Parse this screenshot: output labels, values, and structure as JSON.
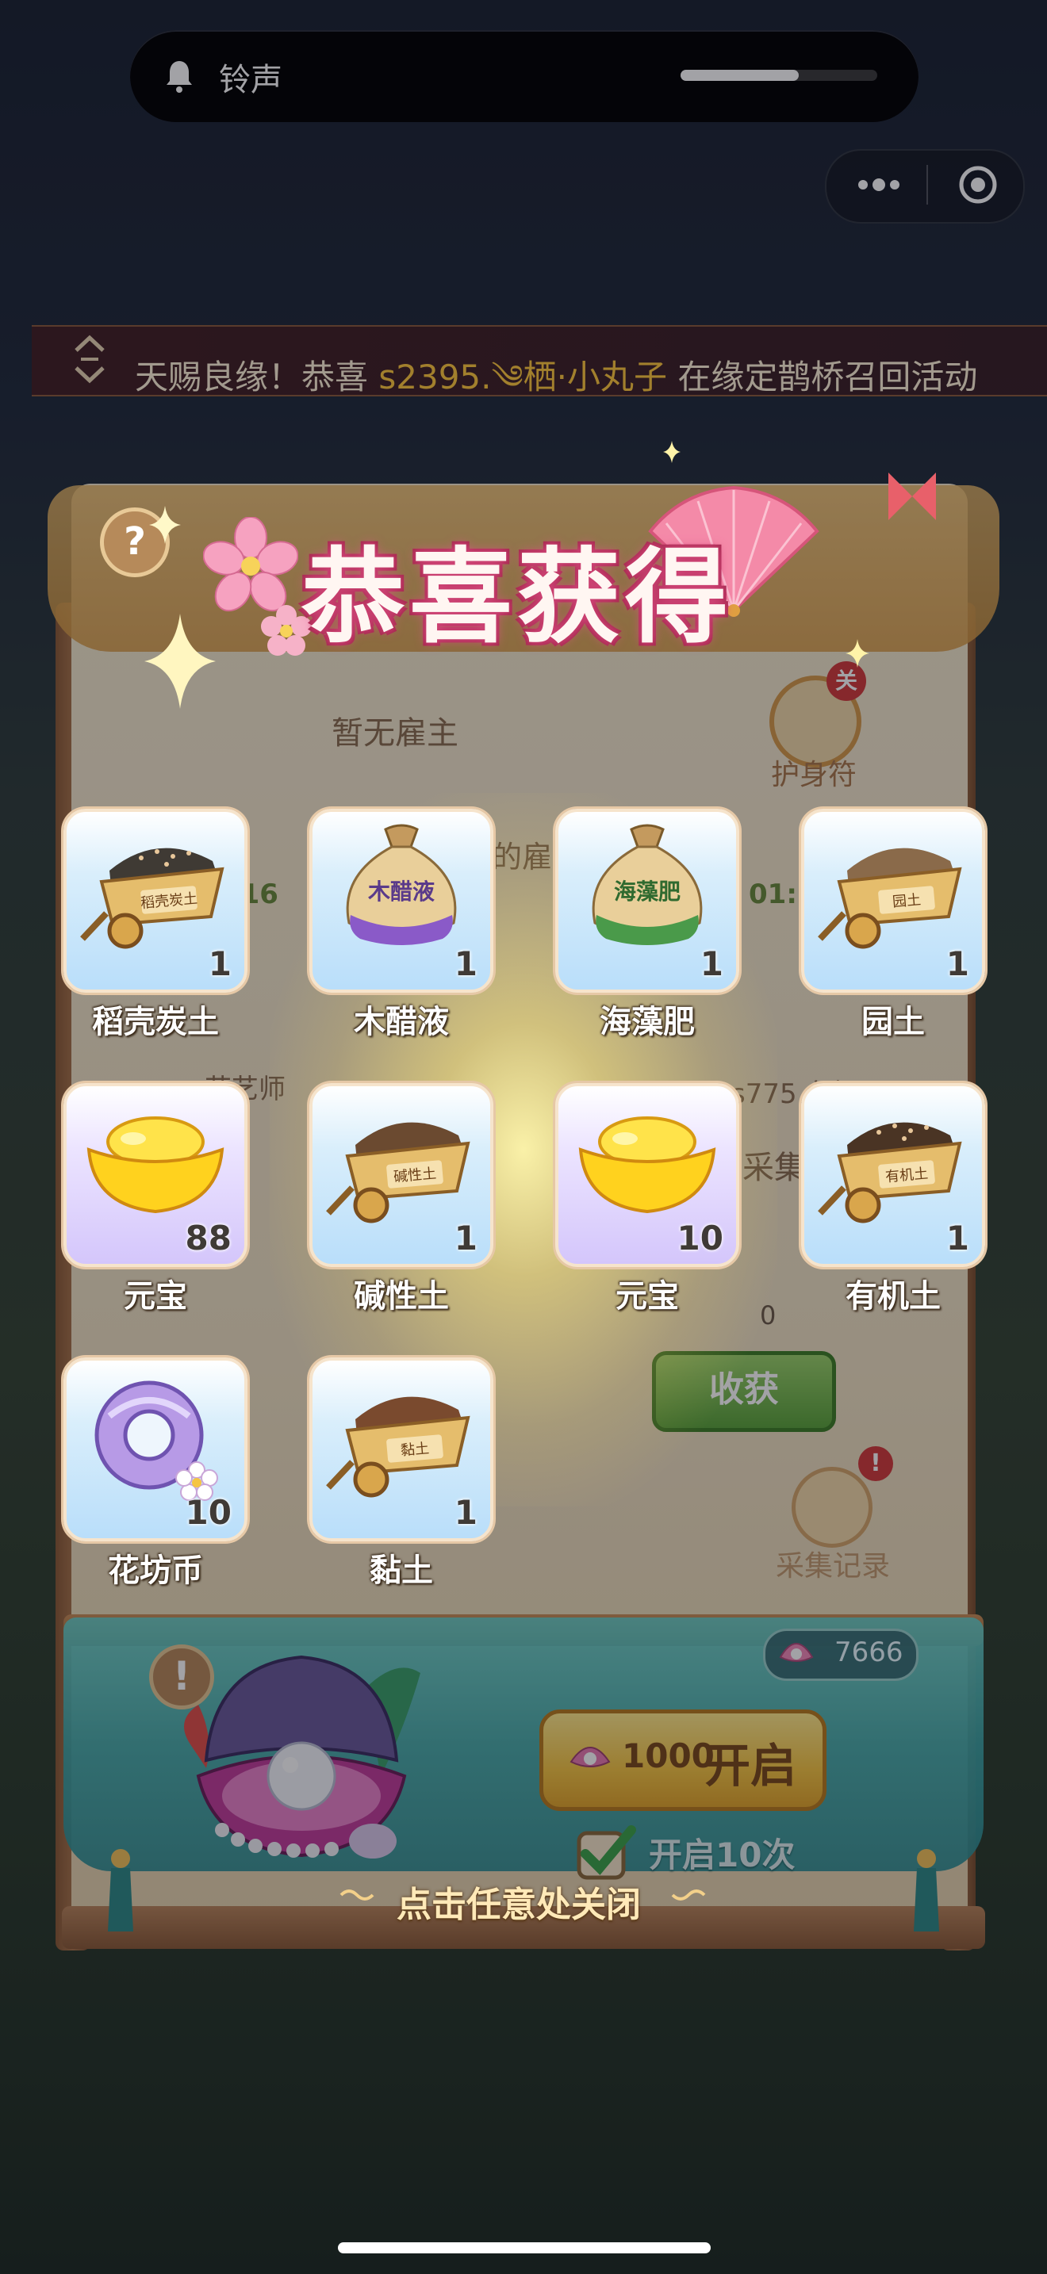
{
  "status_bar": {
    "mode_label": "铃声",
    "volume_level": 0.6
  },
  "marquee": {
    "prefix": "天赐良缘！恭喜",
    "player_name": "s2395.༄栖·小丸子",
    "suffix": "在缘定鹊桥召回活动"
  },
  "background_panel": {
    "no_employer": "暂无雇主",
    "amulet_badge": "关",
    "amulet_label": "护身符",
    "hire_text": "的雇",
    "time_left": ":16",
    "time_right": "01:5",
    "role_text": "花艺师",
    "server_text": "s775.九妈",
    "collect_text": "采集",
    "pearl_count_small": "0",
    "harvest_button": "收获",
    "record_badge": "!",
    "record_label": "采集记录"
  },
  "popup": {
    "title": "恭喜获得",
    "help_icon": "?",
    "rewards": [
      {
        "name": "稻壳炭土",
        "qty": "1",
        "icon": "dark-soil-cart-icon",
        "cart_label": "稻壳炭土",
        "bg": "blue"
      },
      {
        "name": "木醋液",
        "qty": "1",
        "icon": "purple-sack-icon",
        "sack_label": "木醋液",
        "bg": "blue"
      },
      {
        "name": "海藻肥",
        "qty": "1",
        "icon": "green-sack-icon",
        "sack_label": "海藻肥",
        "bg": "blue"
      },
      {
        "name": "园土",
        "qty": "1",
        "icon": "garden-soil-cart-icon",
        "cart_label": "园土",
        "bg": "blue"
      },
      {
        "name": "元宝",
        "qty": "88",
        "icon": "gold-ingot-icon",
        "bg": "purple"
      },
      {
        "name": "碱性土",
        "qty": "1",
        "icon": "alkaline-soil-cart-icon",
        "cart_label": "碱性土",
        "bg": "blue"
      },
      {
        "name": "元宝",
        "qty": "10",
        "icon": "gold-ingot-icon",
        "bg": "purple"
      },
      {
        "name": "有机土",
        "qty": "1",
        "icon": "organic-soil-cart-icon",
        "cart_label": "有机土",
        "bg": "blue"
      },
      {
        "name": "花坊币",
        "qty": "10",
        "icon": "flower-coin-icon",
        "bg": "blue"
      },
      {
        "name": "黏土",
        "qty": "1",
        "icon": "clay-cart-icon",
        "cart_label": "黏土",
        "bg": "blue"
      }
    ],
    "close_hint": "点击任意处关闭"
  },
  "shell_section": {
    "warn_icon": "!",
    "pearl_count": "7666",
    "open_cost": "1000",
    "open_label": "开启",
    "open10_label": "开启10次",
    "open10_checked": true
  },
  "colors": {
    "accent_pink": "#e0548a",
    "gold": "#f5c542",
    "harvest_green": "#5aa33a",
    "teal": "#3ea8a8"
  }
}
